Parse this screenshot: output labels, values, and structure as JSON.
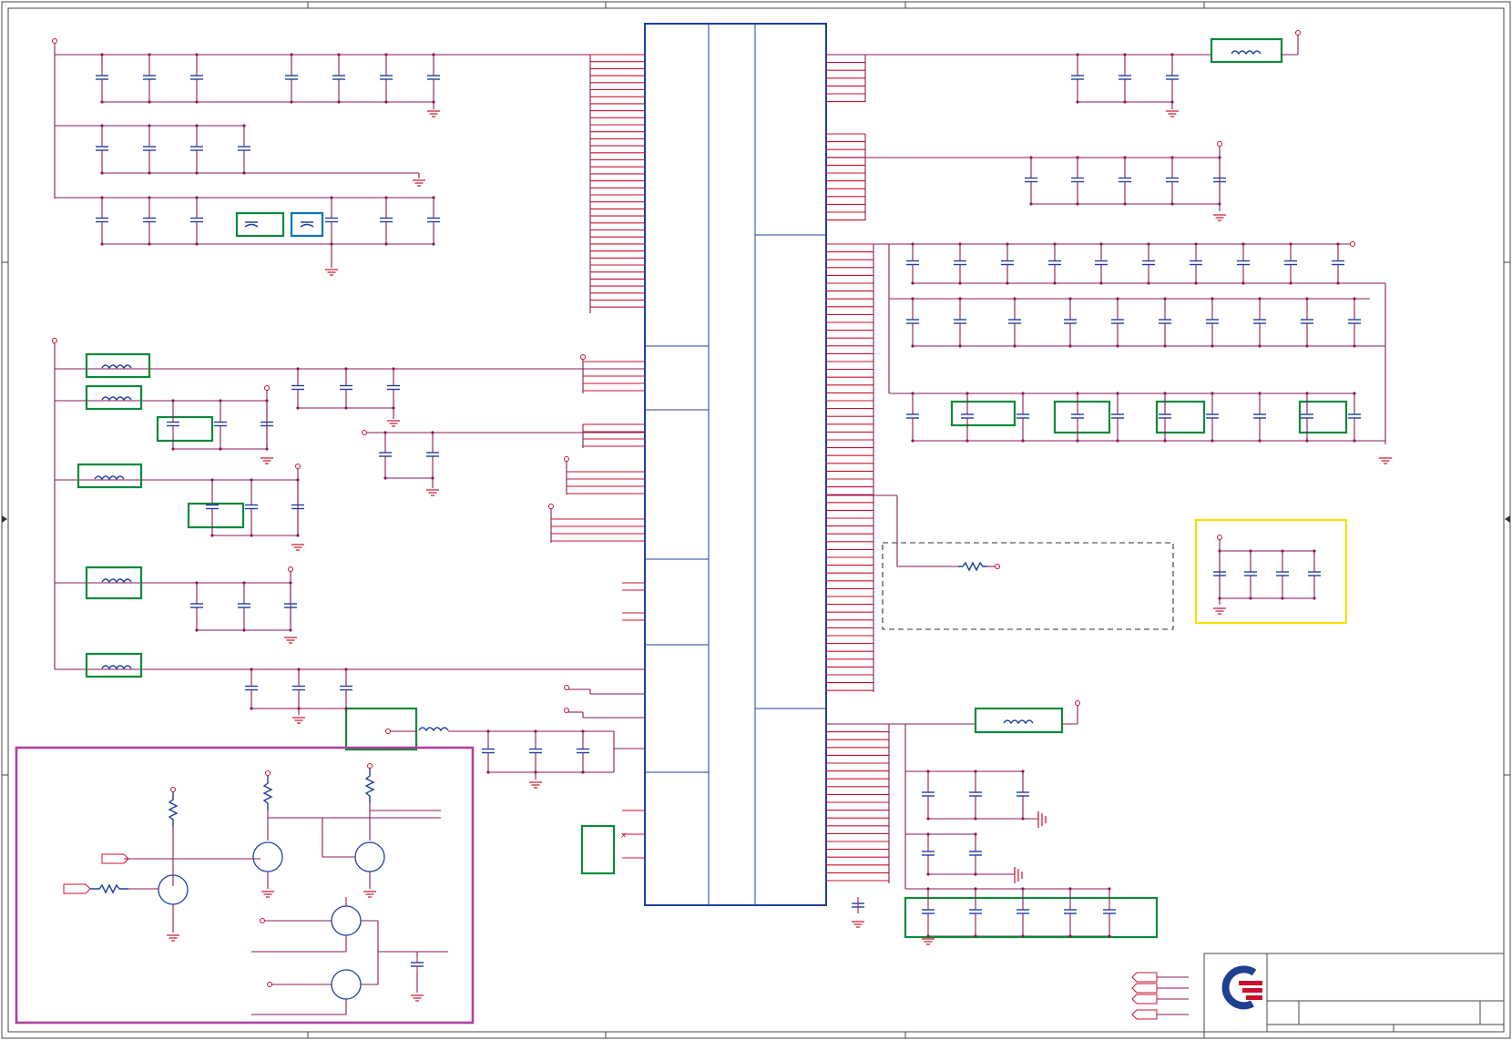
{
  "colors": {
    "wire": "#c8102e",
    "component": "#1f3fa0",
    "highlight_green": "#0a8a3a",
    "highlight_blue": "#0a73c0",
    "highlight_yellow": "#f5e10a",
    "highlight_magenta": "#b040a0",
    "logo_blue": "#1f3f90",
    "logo_red": "#c8102e"
  },
  "icons": {
    "logo": "company-logo-icon"
  }
}
